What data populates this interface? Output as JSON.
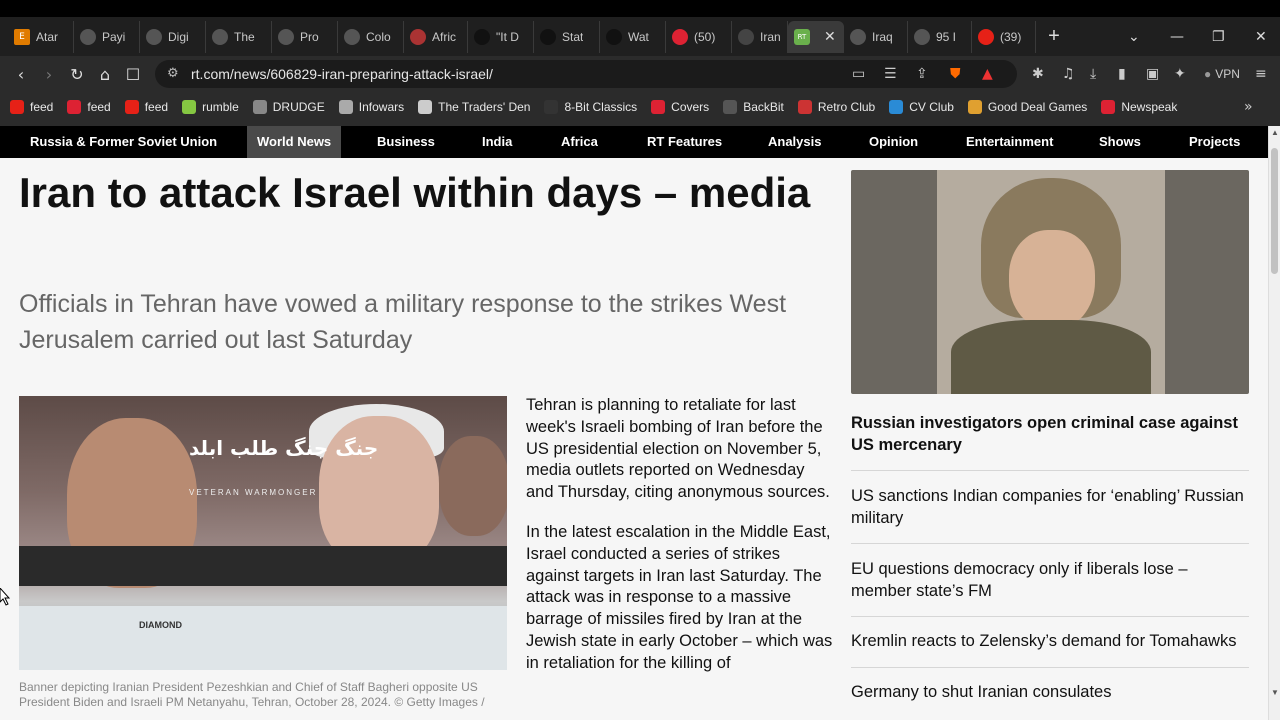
{
  "browser": {
    "tabs": [
      {
        "label": "Atar",
        "icon": "e-icon",
        "color": "#e07b00"
      },
      {
        "label": "Payi",
        "icon": "globe-icon",
        "color": "#555555"
      },
      {
        "label": "Digi",
        "icon": "globe-icon",
        "color": "#555555"
      },
      {
        "label": "The",
        "icon": "globe-icon",
        "color": "#555555"
      },
      {
        "label": "Pro",
        "icon": "globe-icon",
        "color": "#555555"
      },
      {
        "label": "Colo",
        "icon": "building-icon",
        "color": "#555555"
      },
      {
        "label": "Afric",
        "icon": "figure-icon",
        "color": "#a33"
      },
      {
        "label": "\"It D",
        "icon": "github-icon",
        "color": "#111111"
      },
      {
        "label": "Stat",
        "icon": "github-icon",
        "color": "#111111"
      },
      {
        "label": "Wat",
        "icon": "github-icon",
        "color": "#111111"
      },
      {
        "label": "(50)",
        "icon": "app-icon",
        "color": "#d23"
      },
      {
        "label": "Iran",
        "icon": "wordpress-icon",
        "color": "#444444"
      },
      {
        "label": "",
        "icon": "rt-icon",
        "color": "#6ab04c",
        "active": true
      },
      {
        "label": "Iraq",
        "icon": "person-icon",
        "color": "#555555"
      },
      {
        "label": "95 I",
        "icon": "person-icon",
        "color": "#555555"
      },
      {
        "label": "(39)",
        "icon": "youtube-icon",
        "color": "#e62117"
      }
    ],
    "url": "rt.com/news/606829-iran-preparing-attack-israel/",
    "vpn_label": "VPN",
    "bookmarks": [
      {
        "label": "feed",
        "color": "#e62117"
      },
      {
        "label": "feed",
        "color": "#d23"
      },
      {
        "label": "feed",
        "color": "#e62117"
      },
      {
        "label": "rumble",
        "color": "#85c742"
      },
      {
        "label": "DRUDGE",
        "color": "#888888"
      },
      {
        "label": "Infowars",
        "color": "#aaaaaa"
      },
      {
        "label": "The Traders' Den",
        "color": "#cccccc"
      },
      {
        "label": "8-Bit Classics",
        "color": "#333333"
      },
      {
        "label": "Covers",
        "color": "#d23"
      },
      {
        "label": "BackBit",
        "color": "#555555"
      },
      {
        "label": "Retro Club",
        "color": "#c33"
      },
      {
        "label": "CV Club",
        "color": "#2a8bd6"
      },
      {
        "label": "Good Deal Games",
        "color": "#e0a030"
      },
      {
        "label": "Newspeak",
        "color": "#d23"
      }
    ]
  },
  "site_nav": [
    {
      "label": "Russia & Former Soviet Union"
    },
    {
      "label": "World News",
      "active": true
    },
    {
      "label": "Business"
    },
    {
      "label": "India"
    },
    {
      "label": "Africa"
    },
    {
      "label": "RT Features"
    },
    {
      "label": "Analysis"
    },
    {
      "label": "Opinion"
    },
    {
      "label": "Entertainment"
    },
    {
      "label": "Shows"
    },
    {
      "label": "Projects"
    }
  ],
  "article": {
    "headline": "Iran to attack Israel within days – media",
    "summary": "Officials in Tehran have vowed a military response to the strikes West Jerusalem carried out last Saturday",
    "image_text": "جنگ جنگ طلب ابلد",
    "image_subtext": "VETERAN WARMONGER",
    "image_store_sign": "DIAMOND",
    "caption": "Banner depicting Iranian President Pezeshkian and Chief of Staff Bagheri opposite US President Biden and Israeli PM Netanyahu, Tehran, October 28, 2024. © Getty Images /",
    "paragraphs": [
      "Tehran is planning to retaliate for last week's Israeli bombing of Iran before the US presidential election on November 5, media outlets reported on Wednesday and Thursday, citing anonymous sources.",
      "In the latest escalation in the Middle East, Israel conducted a series of strikes against targets in Iran last Saturday. The attack was in response to a massive barrage of missiles fired by Iran at the Jewish state in early October – which was in retaliation for the killing of"
    ]
  },
  "sidebar": {
    "lead": "Russian investigators open criminal case against US mercenary",
    "items": [
      "US sanctions Indian companies for ‘enabling’ Russian military",
      "EU questions democracy only if liberals lose – member state’s FM",
      "Kremlin reacts to Zelensky’s demand for Tomahawks",
      "Germany to shut Iranian consulates"
    ]
  }
}
